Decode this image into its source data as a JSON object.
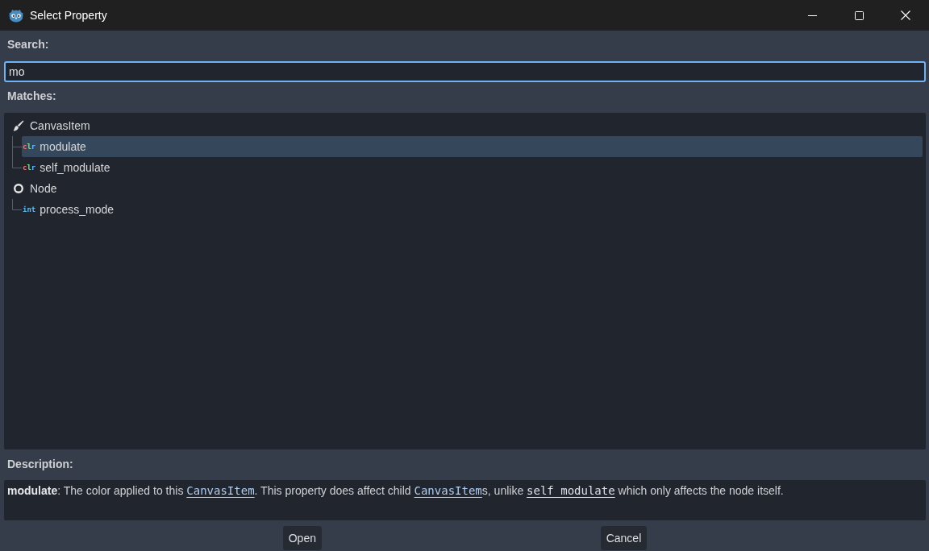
{
  "window": {
    "title": "Select Property"
  },
  "search": {
    "label": "Search:",
    "value": "mo",
    "focused": true
  },
  "matches": {
    "label": "Matches:",
    "groups": [
      {
        "name": "CanvasItem",
        "kind": "brush",
        "selected": false,
        "children": [
          {
            "name": "modulate",
            "type": "clr",
            "kind": "color",
            "selected": true
          },
          {
            "name": "self_modulate",
            "type": "clr",
            "kind": "color",
            "selected": false
          }
        ]
      },
      {
        "name": "Node",
        "kind": "ring",
        "selected": false,
        "children": [
          {
            "name": "process_mode",
            "type": "int",
            "kind": "int",
            "selected": false
          }
        ]
      }
    ]
  },
  "description": {
    "label": "Description:",
    "segments": [
      {
        "kind": "bold",
        "text": "modulate"
      },
      {
        "kind": "plain",
        "text": ": The color applied to this "
      },
      {
        "kind": "class_link",
        "text": "CanvasItem"
      },
      {
        "kind": "plain",
        "text": ". This property does affect child "
      },
      {
        "kind": "class_link",
        "text": "CanvasItem"
      },
      {
        "kind": "plain",
        "text": "s, unlike "
      },
      {
        "kind": "member_link",
        "text": "self_modulate"
      },
      {
        "kind": "plain",
        "text": " which only affects the node itself."
      }
    ]
  },
  "buttons": [
    {
      "label": "Open"
    },
    {
      "label": "Cancel"
    }
  ]
}
